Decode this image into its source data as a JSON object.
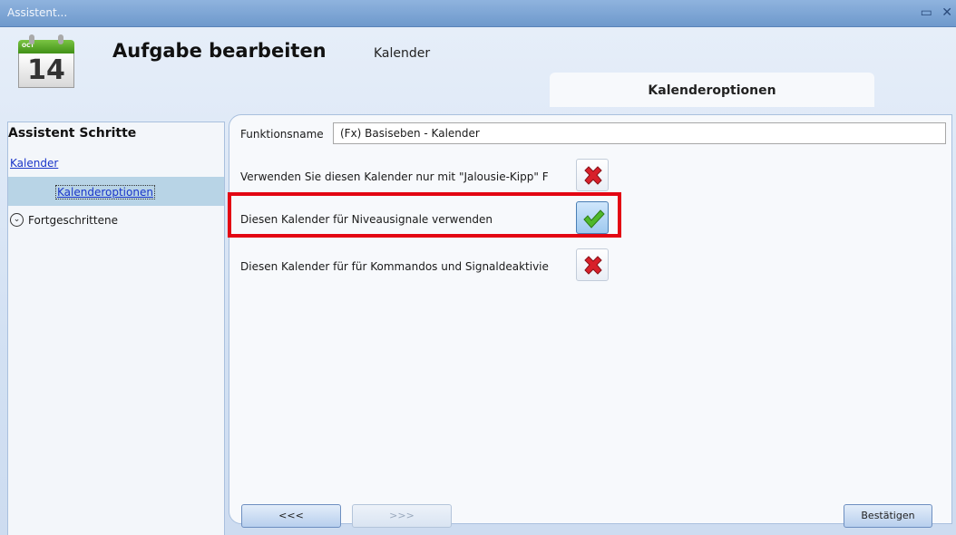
{
  "window": {
    "title": "Assistent...",
    "restore_glyph": "▭",
    "close_glyph": "✕"
  },
  "header": {
    "calendar_month": "OCT",
    "calendar_day": "14",
    "title": "Aufgabe bearbeiten",
    "subtitle": "Kalender",
    "active_tab": "Kalenderoptionen"
  },
  "sidebar": {
    "title": "Assistent Schritte",
    "items": [
      {
        "label": "Kalender"
      },
      {
        "label": "Kalenderoptionen",
        "selected": true
      }
    ],
    "advanced": {
      "label": "Fortgeschrittene",
      "icon": "chevron-down-icon"
    }
  },
  "form": {
    "function_name_label": "Funktionsname",
    "function_name_value": "(Fx) Basiseben - Kalender",
    "options": [
      {
        "label": "Verwenden Sie diesen Kalender nur mit \"Jalousie-Kipp\" F",
        "state": "off",
        "icon": "red-x-icon"
      },
      {
        "label": "Diesen Kalender für Niveausignale verwenden",
        "state": "on",
        "icon": "green-check-icon",
        "highlighted": true
      },
      {
        "label": "Diesen Kalender für für Kommandos und Signaldeaktivie",
        "state": "off",
        "icon": "red-x-icon"
      }
    ]
  },
  "footer": {
    "back_label": "<<<",
    "next_label": ">>>",
    "confirm_label": "Bestätigen"
  },
  "colors": {
    "highlight": "#e30613",
    "link": "#1a35c9",
    "selected_bg": "#b8d4e6"
  }
}
